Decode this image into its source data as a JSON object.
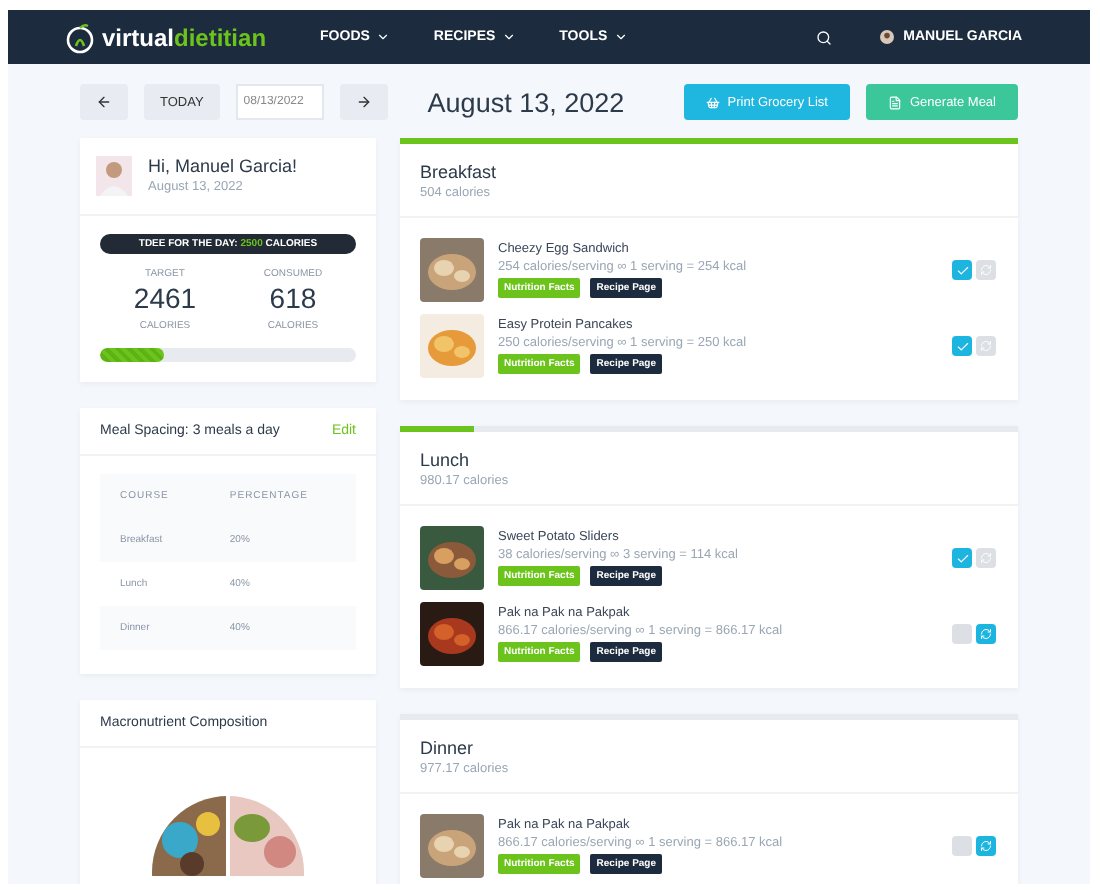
{
  "nav": {
    "logo": {
      "first": "virtual",
      "second": "dietitian"
    },
    "menu": [
      {
        "label": "FOODS"
      },
      {
        "label": "RECIPES"
      },
      {
        "label": "TOOLS"
      }
    ],
    "user": "MANUEL GARCIA"
  },
  "toolbar": {
    "today": "TODAY",
    "date_value": "08/13/2022",
    "heading": "August 13, 2022",
    "buttons": [
      {
        "label": "Print Grocery List",
        "kind": "print"
      },
      {
        "label": "Generate Meal",
        "kind": "generate"
      }
    ]
  },
  "profile": {
    "greeting": "Hi, Manuel Garcia!",
    "date": "August 13, 2022",
    "tdee": {
      "label": "TDEE FOR THE DAY:",
      "value": "2500",
      "unit": "CALORIES"
    },
    "stats": [
      {
        "label": "TARGET",
        "value": "2461",
        "unit": "CALORIES"
      },
      {
        "label": "CONSUMED",
        "value": "618",
        "unit": "CALORIES"
      }
    ],
    "level": 0.25
  },
  "meal_spacing": {
    "title": "Meal Spacing:",
    "value": "3 meals a day",
    "edit": "Edit",
    "columns": [
      "COURSE",
      "PERCENTAGE"
    ],
    "rows": [
      [
        "Breakfast",
        "20%"
      ],
      [
        "Lunch",
        "40%"
      ],
      [
        "Dinner",
        "40%"
      ]
    ]
  },
  "macronutrients": {
    "title": "Macronutrient Composition"
  },
  "meals": [
    {
      "name": "Breakfast",
      "calories": "504 calories",
      "level": 1,
      "items": [
        {
          "name": "Cheezy Egg Sandwich",
          "detail": "254 calories/serving ∞ 1 serving = 254 kcal",
          "facts": "Nutrition Facts",
          "recipe": "Recipe Page",
          "eaten": true
        },
        {
          "name": "Easy Protein Pancakes",
          "detail": "250 calories/serving ∞ 1 serving = 250 kcal",
          "facts": "Nutrition Facts",
          "recipe": "Recipe Page",
          "eaten": true
        }
      ]
    },
    {
      "name": "Lunch",
      "calories": "980.17 calories",
      "level": 0.12,
      "items": [
        {
          "name": "Sweet Potato Sliders",
          "detail": "38 calories/serving ∞ 3 serving = 114 kcal",
          "facts": "Nutrition Facts",
          "recipe": "Recipe Page",
          "eaten": true
        },
        {
          "name": "Pak na Pak na Pakpak",
          "detail": "866.17 calories/serving ∞ 1 serving = 866.17 kcal",
          "facts": "Nutrition Facts",
          "recipe": "Recipe Page",
          "eaten": false
        }
      ]
    },
    {
      "name": "Dinner",
      "calories": "977.17 calories",
      "items": [
        {
          "name": "Pak na Pak na Pakpak",
          "detail": "866.17 calories/serving ∞ 1 serving = 866.17 kcal",
          "facts": "Nutrition Facts",
          "recipe": "Recipe Page",
          "eaten": false
        }
      ]
    }
  ]
}
